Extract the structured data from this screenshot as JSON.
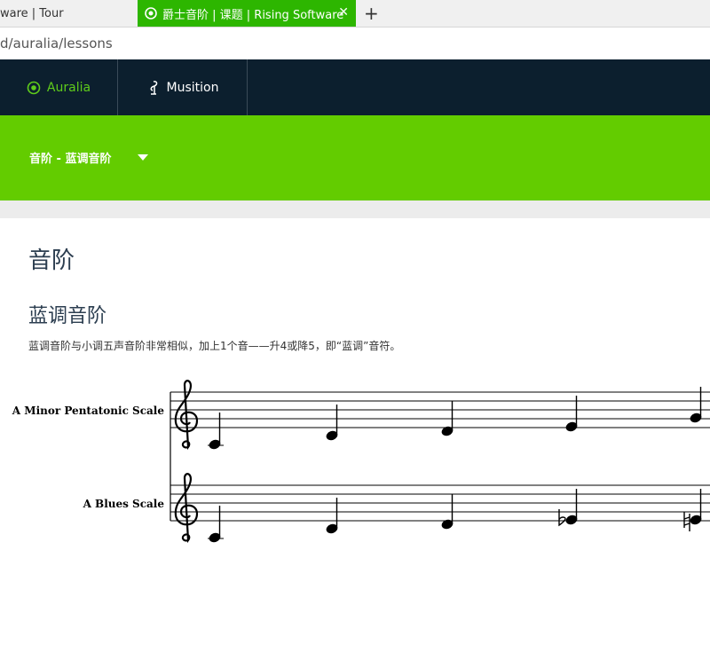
{
  "browser": {
    "tabs": [
      {
        "title": "ware | Tour",
        "active": false
      },
      {
        "title": "爵士音阶 | 课题 | Rising Software",
        "active": true
      }
    ],
    "close_glyph": "✕",
    "new_tab_glyph": "+",
    "address": "d/auralia/lessons"
  },
  "topnav": {
    "items": [
      {
        "label": "Auralia",
        "icon": "auralia-logo-icon"
      },
      {
        "label": "Musition",
        "icon": "musition-logo-icon"
      }
    ]
  },
  "lesson_bar": {
    "breadcrumb": "音阶 - 蓝调音阶",
    "icon": "caret-down-icon"
  },
  "content": {
    "title": "音阶",
    "subtitle": "蓝调音阶",
    "description": "蓝调音阶与小调五声音阶非常相似，加上1个音——升4或降5，即“蓝调”音符。",
    "staves": [
      {
        "label": "A Minor Pentatonic Scale"
      },
      {
        "label": "A Blues Scale"
      }
    ]
  },
  "colors": {
    "brand_green": "#63cc00",
    "nav_dark": "#0c1f2e",
    "tab_green": "#2db600"
  }
}
